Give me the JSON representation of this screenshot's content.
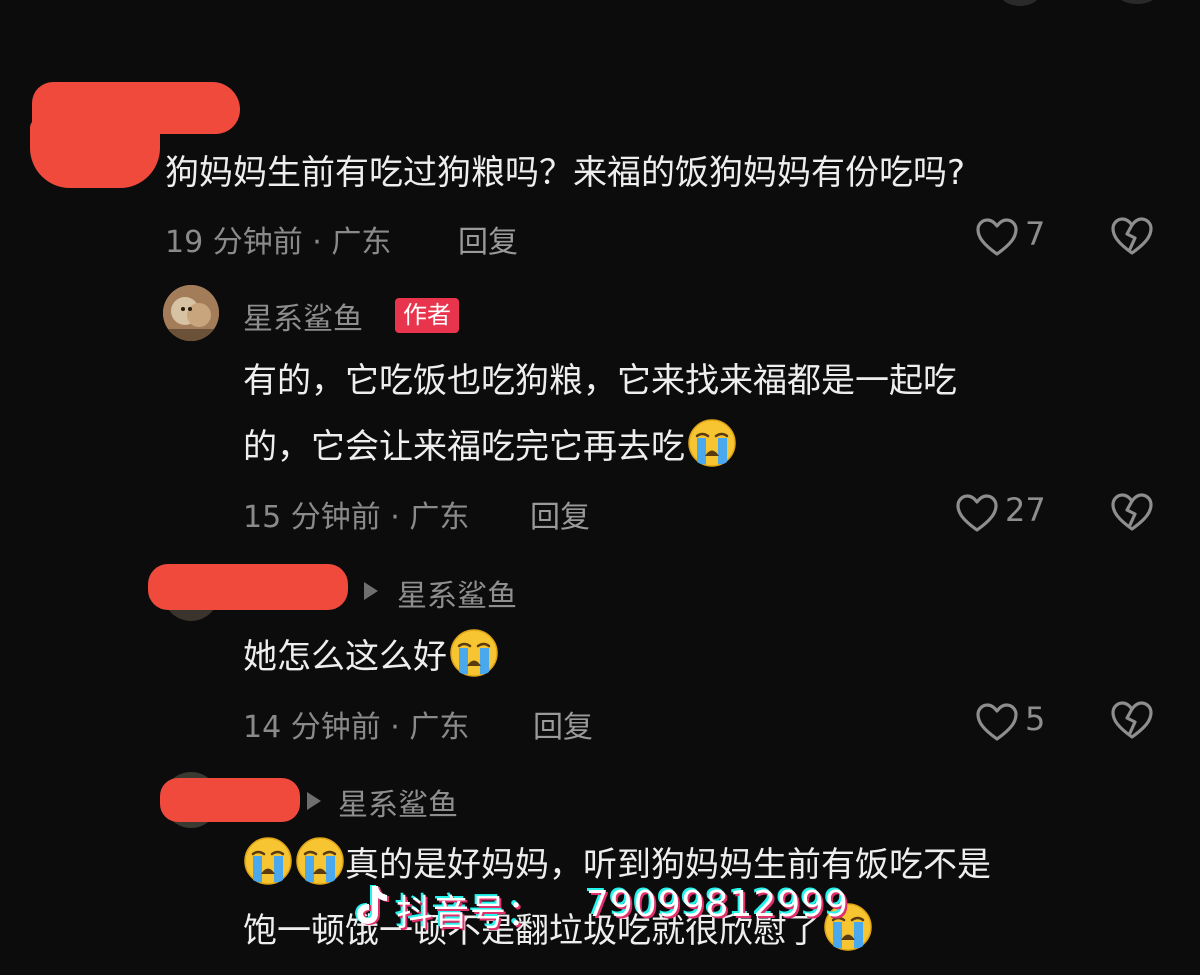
{
  "comments": [
    {
      "text": "狗妈妈生前有吃过狗粮吗？来福的饭狗妈妈有份吃吗?",
      "time_location": "19 分钟前 · 广东",
      "reply_label": "回复",
      "likes": "7"
    },
    {
      "username": "星系鲨鱼",
      "badge": "作者",
      "text_line1": "有的，它吃饭也吃狗粮，它来找来福都是一起吃",
      "text_line2": "的，它会让来福吃完它再去吃",
      "time_location": "15 分钟前 · 广东",
      "reply_label": "回复",
      "likes": "27"
    },
    {
      "reply_to": "星系鲨鱼",
      "text": "她怎么这么好",
      "time_location": "14 分钟前 · 广东",
      "reply_label": "回复",
      "likes": "5"
    },
    {
      "reply_to": "星系鲨鱼",
      "text_line1": "真的是好妈妈，听到狗妈妈生前有饭吃不是",
      "text_line2": "饱一顿饿一顿不是翻垃圾吃就很欣慰了"
    }
  ],
  "watermark": {
    "label": "抖音号：",
    "id": "79099812999"
  },
  "colors": {
    "background": "#0c0c0c",
    "badge": "#e8354d",
    "redaction": "#f04a3d",
    "meta_text": "#8a8a8a"
  },
  "icons": [
    "heart-outline-icon",
    "broken-heart-icon",
    "triangle-right-icon",
    "loudly-crying-face-emoji",
    "tiktok-logo-icon"
  ]
}
